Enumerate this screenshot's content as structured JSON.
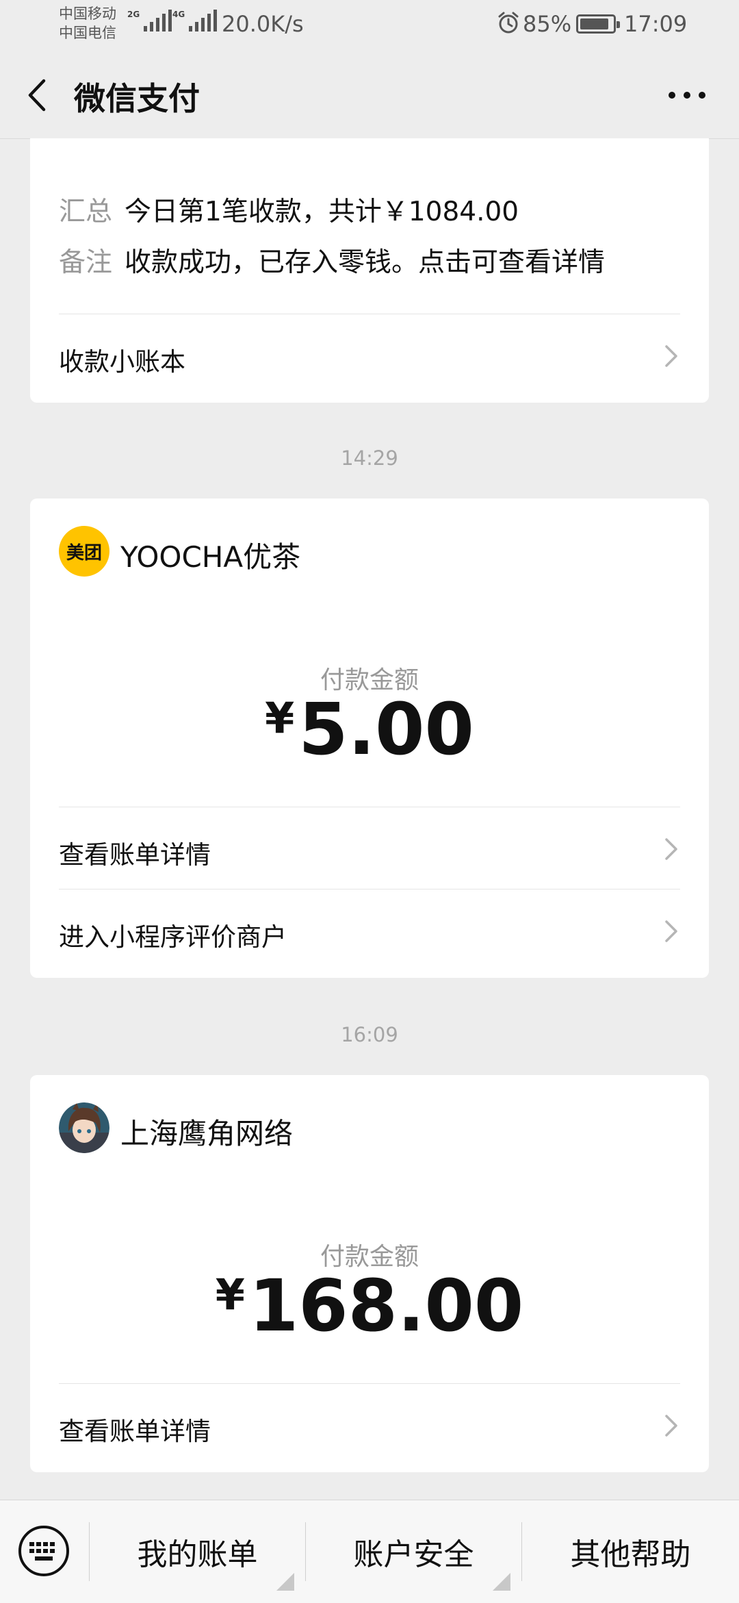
{
  "status_bar": {
    "carrier_1": "中国移动",
    "carrier_2": "中国电信",
    "signal_1_tag": "2G",
    "signal_2_tag": "4G",
    "net_speed": "20.0K/s",
    "battery": "85%",
    "time": "17:09"
  },
  "nav": {
    "title": "微信支付",
    "back_icon": "chevron-left-icon",
    "more_icon": "more-dots-icon"
  },
  "card1": {
    "summary_key": "汇总",
    "summary_value": "今日第1笔收款，共计￥1084.00",
    "note_key": "备注",
    "note_value": "收款成功，已存入零钱。点击可查看详情",
    "link": "收款小账本"
  },
  "messages": [
    {
      "timestamp": "14:29",
      "logo_text": "美团",
      "merchant": "YOOCHA优茶",
      "amount_label": "付款金额",
      "currency": "¥",
      "amount": "5.00",
      "links": [
        "查看账单详情",
        "进入小程序评价商户"
      ]
    },
    {
      "timestamp": "16:09",
      "merchant": "上海鹰角网络",
      "amount_label": "付款金额",
      "currency": "¥",
      "amount": "168.00",
      "links": [
        "查看账单详情"
      ]
    }
  ],
  "bottom_menu": {
    "keyboard_icon": "keyboard-icon",
    "items": [
      "我的账单",
      "账户安全",
      "其他帮助"
    ]
  },
  "colors": {
    "background": "#ededed",
    "card": "#ffffff",
    "meituan_yellow": "#ffc300",
    "muted_text": "#999999"
  }
}
